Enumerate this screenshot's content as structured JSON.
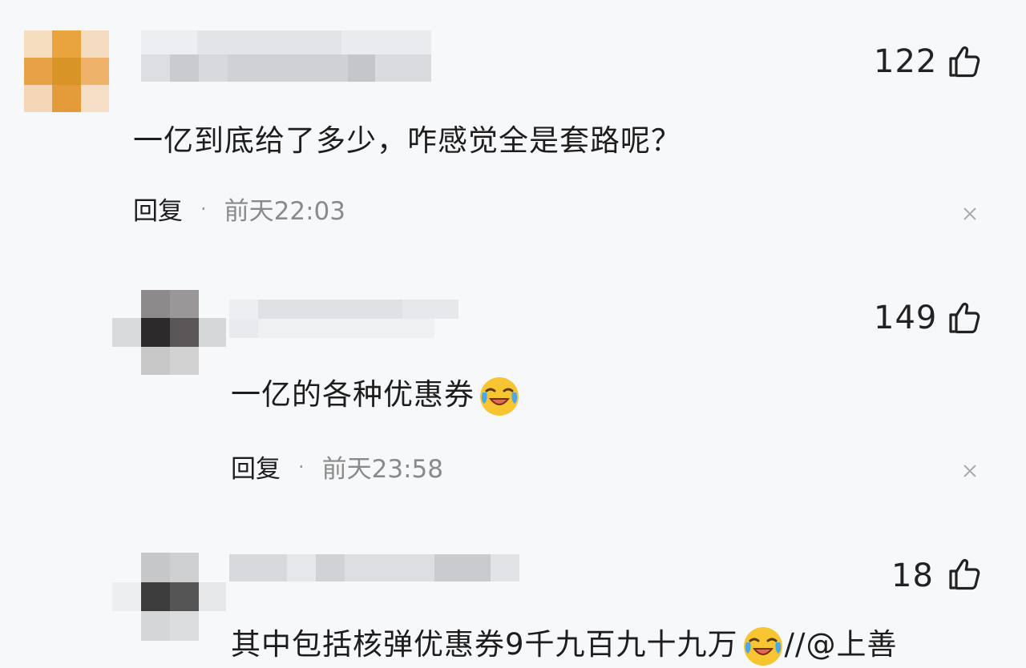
{
  "comments": [
    {
      "likes": "122",
      "text": "一亿到底给了多少，咋感觉全是套路呢？",
      "reply_label": "回复",
      "separator": "·",
      "time": "前天22:03"
    },
    {
      "likes": "149",
      "text": "一亿的各种优惠券",
      "reply_label": "回复",
      "separator": "·",
      "time": "前天23:58"
    },
    {
      "likes": "18",
      "text_before_emoji": "其中包括核弹优惠券9千九百九十九万",
      "text_after_emoji": "//@上善"
    }
  ],
  "icons": {
    "like": "thumbs-up-icon",
    "close": "close-icon",
    "emoji": "laughing-crying-emoji"
  }
}
